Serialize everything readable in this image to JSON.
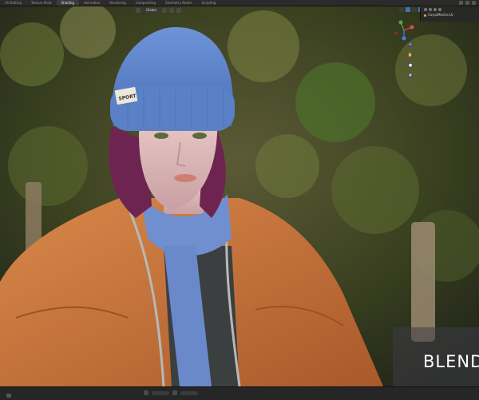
{
  "workspace_tabs": [
    {
      "label": "UV Editing",
      "active": false
    },
    {
      "label": "Texture Paint",
      "active": false
    },
    {
      "label": "Shading",
      "active": true
    },
    {
      "label": "Animation",
      "active": false
    },
    {
      "label": "Rendering",
      "active": false
    },
    {
      "label": "Compositing",
      "active": false
    },
    {
      "label": "Geometry Nodes",
      "active": false
    },
    {
      "label": "Scripting",
      "active": false
    }
  ],
  "viewport_header": {
    "orientation": "Global"
  },
  "outliner": {
    "item": "CorpsMeshe.LV"
  },
  "hat_tag": "SPORT",
  "overlay_brand": "BLEND",
  "colors": {
    "accent": "#4772b3",
    "jacket": "#c9763a",
    "beanie": "#5e84c9",
    "scarf": "#6f8fd0",
    "hair": "#7a2a55"
  },
  "icons": {
    "gizmo": "navigation-gizmo-icon",
    "zoom": "zoom-icon",
    "pan": "hand-icon",
    "camera": "camera-icon",
    "ortho": "grid-icon"
  }
}
